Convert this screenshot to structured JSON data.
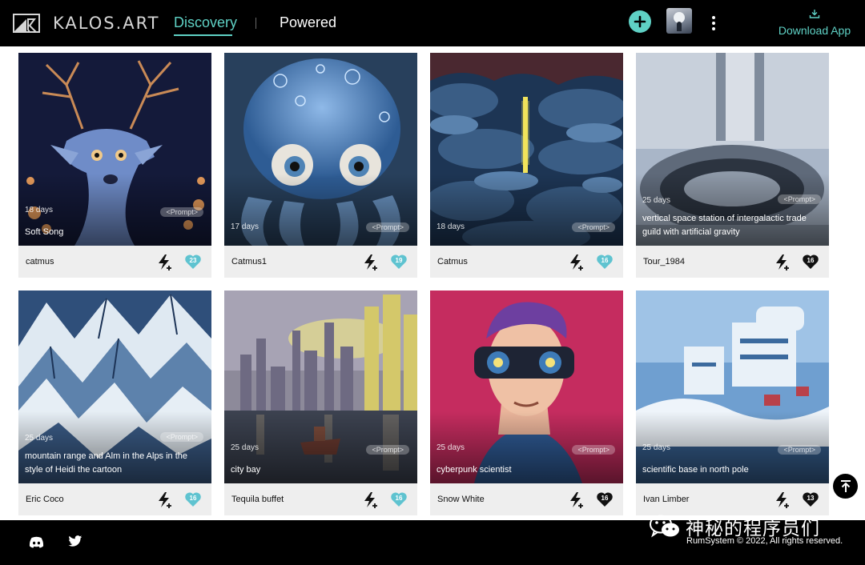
{
  "header": {
    "logo_text": "KALOS.ART",
    "nav": [
      {
        "label": "Discovery",
        "active": true
      },
      {
        "label": "Powered",
        "active": false
      }
    ],
    "download_label": "Download App"
  },
  "cards": [
    {
      "days": "18 days",
      "title": "Soft Song",
      "prompt": "<Prompt>",
      "user": "catmus",
      "likes": "23",
      "liked": false,
      "theme": "deer"
    },
    {
      "days": "17 days",
      "title": "",
      "prompt": "<Prompt>",
      "user": "Catmus1",
      "likes": "19",
      "liked": false,
      "theme": "octopus"
    },
    {
      "days": "18 days",
      "title": "",
      "prompt": "<Prompt>",
      "user": "Catmus",
      "likes": "16",
      "liked": false,
      "theme": "clouds"
    },
    {
      "days": "25 days",
      "title": "vertical space station of intergalactic trade guild with artificial gravity",
      "prompt": "<Prompt>",
      "user": "Tour_1984",
      "likes": "16",
      "liked": true,
      "theme": "station"
    },
    {
      "days": "25 days",
      "title": "mountain range and Alm in the Alps in the style of Heidi the cartoon",
      "prompt": "<Prompt>",
      "user": "Eric Coco",
      "likes": "16",
      "liked": false,
      "theme": "mountains"
    },
    {
      "days": "25 days",
      "title": "city bay",
      "prompt": "<Prompt>",
      "user": "Tequila buffet",
      "likes": "16",
      "liked": false,
      "theme": "city"
    },
    {
      "days": "25 days",
      "title": "cyberpunk scientist",
      "prompt": "<Prompt>",
      "user": "Snow White",
      "likes": "16",
      "liked": true,
      "theme": "cyberpunk"
    },
    {
      "days": "25 days",
      "title": "scientific base in north pole",
      "prompt": "<Prompt>",
      "user": "Ivan Limber",
      "likes": "13",
      "liked": true,
      "theme": "base"
    }
  ],
  "footer": {
    "watermark": "神秘的程序员们",
    "copyright": "RumSystem © 2022, All rights reserved."
  },
  "colors": {
    "accent": "#5fd1c5",
    "header_bg": "#000000",
    "card_bg": "#eeeeee"
  }
}
